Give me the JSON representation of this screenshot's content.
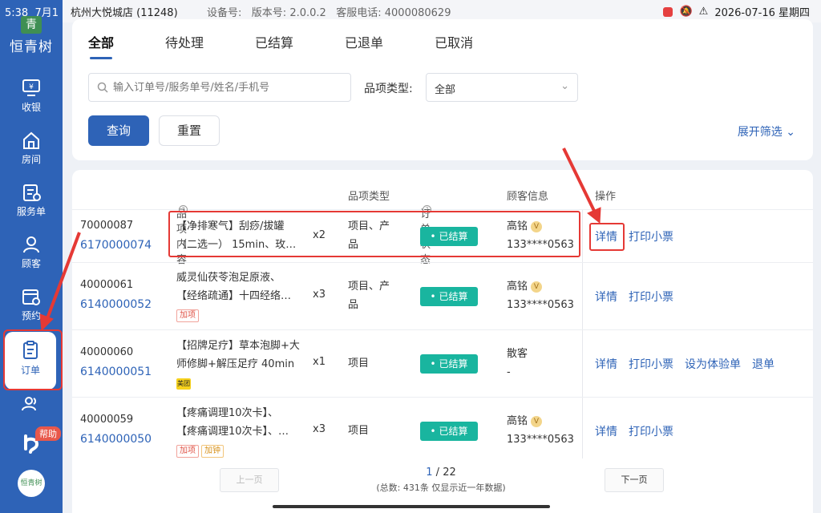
{
  "status_bar": {
    "time": "5:38",
    "date_short": "7月1",
    "store": "杭州大悦城店",
    "store_id": "(11248)",
    "device_label": "设备号:",
    "version_label": "版本号:",
    "version": "2.0.0.2",
    "hotline_label": "客服电话:",
    "hotline": "4000080629",
    "datetime": "2026-07-16 星期四"
  },
  "brand": {
    "mark": "青",
    "name": "恒青树"
  },
  "sidebar": {
    "items": [
      {
        "label": "收银",
        "icon": "cashier-icon"
      },
      {
        "label": "房间",
        "icon": "home-icon"
      },
      {
        "label": "服务单",
        "icon": "service-order-icon"
      },
      {
        "label": "顾客",
        "icon": "customer-icon"
      },
      {
        "label": "预约",
        "icon": "calendar-icon"
      },
      {
        "label": "订单",
        "icon": "order-icon",
        "active": true
      },
      {
        "label": "",
        "icon": "staff-icon"
      }
    ],
    "help_label": "帮助",
    "bottom_logo": "恒青树"
  },
  "tabs": [
    "全部",
    "待处理",
    "已结算",
    "已退单",
    "已取消"
  ],
  "filters": {
    "search_placeholder": "输入订单号/服务单号/姓名/手机号",
    "category_label": "品项类型:",
    "category_value": "全部",
    "query_label": "查询",
    "reset_label": "重置",
    "expand_label": "展开筛选"
  },
  "table": {
    "headers": {
      "content": "品项内容",
      "type": "品项类型",
      "status": "订单状态",
      "customer": "顾客信息",
      "ops": "操作"
    },
    "rows": [
      {
        "order_a": "70000087",
        "order_b": "6170000074",
        "content_1": "【净排寒气】刮痧/拔罐",
        "content_2": "（二选一） 15min、玫…",
        "qty": "x2",
        "type_1": "项目、产",
        "type_2": "品",
        "status": "• 已结算",
        "cust_1": "高铭",
        "cust_2": "133****0563",
        "tags": [],
        "ops": [
          "详情",
          "打印小票"
        ]
      },
      {
        "order_a": "40000061",
        "order_b": "6140000052",
        "content_1": "威灵仙茯苓泡足原液、",
        "content_2": "【经络疏通】十四经络…",
        "qty": "x3",
        "type_1": "项目、产",
        "type_2": "品",
        "status": "• 已结算",
        "cust_1": "高铭",
        "cust_2": "133****0563",
        "tags": [
          "加项"
        ],
        "ops": [
          "详情",
          "打印小票"
        ]
      },
      {
        "order_a": "40000060",
        "order_b": "6140000051",
        "content_1": "【招牌足疗】草本泡脚+大",
        "content_2": "师修脚+解压足疗 40min",
        "qty": "x1",
        "type_1": "项目",
        "type_2": "",
        "status": "• 已结算",
        "cust_1": "散客",
        "cust_2": "-",
        "tags": [],
        "ops": [
          "详情",
          "打印小票",
          "设为体验单",
          "退单"
        ]
      },
      {
        "order_a": "40000059",
        "order_b": "6140000050",
        "content_1": "【疼痛调理10次卡】、",
        "content_2": "【疼痛调理10次卡】、…",
        "qty": "x3",
        "type_1": "项目",
        "type_2": "",
        "status": "• 已结算",
        "cust_1": "高铭",
        "cust_2": "133****0563",
        "tags": [
          "加项",
          "加钟"
        ],
        "ops": [
          "详情",
          "打印小票"
        ]
      }
    ]
  },
  "pagination": {
    "prev_label": "上一页",
    "next_label": "下一页",
    "page_current": "1",
    "page_sep": "/",
    "page_total": "22",
    "summary": "(总数: 431条 仅显示近一年数据)"
  },
  "meituan_label": "美团",
  "vip_badge": "V",
  "colors": {
    "primary": "#2e63b7",
    "status_green": "#19b59f",
    "annotation_red": "#e53935"
  }
}
